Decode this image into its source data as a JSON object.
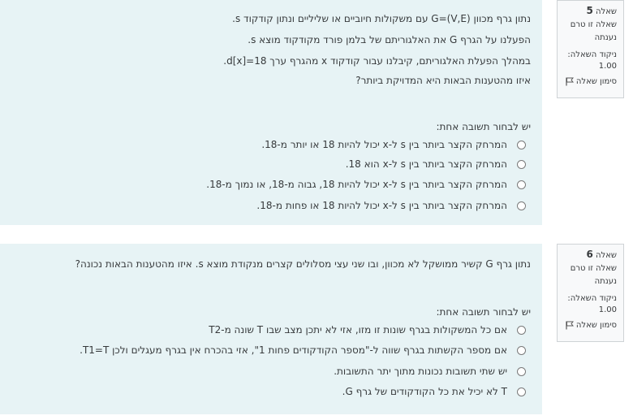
{
  "q5": {
    "label": "שאלה",
    "number": "5",
    "state": "שאלה זו טרם נענתה",
    "grade_label": "ניקוד השאלה:",
    "grade_value": "1.00",
    "flag": "סימון שאלה",
    "text": [
      "נתון גרף מכוון G=(V,E) עם משקולות חיוביים או שליליים ונתון קודקוד s.",
      "הפעלנו על הגרף G את האלגוריתם של בלמן פורד מקודקוד מוצא s.",
      "במהלך הפעלת האלגוריתם, קיבלנו עבור קודקוד  x מהגרף ערך d[x]=18.",
      "איזו מהטענות הבאות היא המדויקת ביותר?"
    ],
    "prompt": "יש לבחור תשובה אחת:",
    "options": [
      "המרחק הקצר ביותר בין s ל-x יכול להיות 18 או יותר מ-18.",
      "המרחק הקצר ביותר בין s ל-x הוא 18.",
      "המרחק הקצר ביותר בין s ל-x יכול להיות 18, גבוה מ-18, או נמוך מ-18.",
      "המרחק הקצר ביותר בין s ל-x יכול להיות 18 או פחות מ-18."
    ]
  },
  "q6": {
    "label": "שאלה",
    "number": "6",
    "state": "שאלה זו טרם נענתה",
    "grade_label": "ניקוד השאלה:",
    "grade_value": "1.00",
    "flag": "סימון שאלה",
    "text": [
      "נתון גרף G קשיר ממושקל לא מכוון, ובו שני עצי מסלולים קצרים מנקודת מוצא s. איזו מהטענות הבאות נכונה?"
    ],
    "prompt": "יש לבחור תשובה אחת:",
    "options": [
      "אם כל המשקולות בגרף שונות זו מזו, אזי לא יתכן מצב שבו T שונה מ-T2",
      "אם מספר הקשתות בגרף שווה ל-\"מספר הקודקודים פחות 1\", אזי בהכרח אין בגרף מעגלים ולכן T1=T.",
      "יש שתי תשובות נכונות מתוך יתר התשובות.",
      "T לא יכיל את כל הקודקודים של גרף G."
    ]
  },
  "colors": {
    "panel": "#e7f3f5",
    "info": "#f8f9fa"
  }
}
